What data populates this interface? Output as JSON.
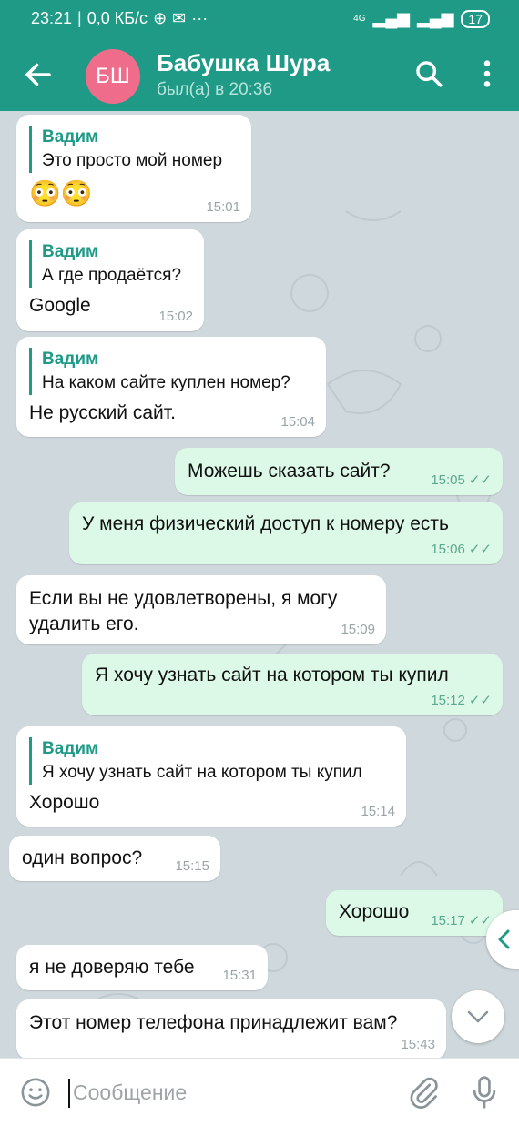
{
  "status": {
    "time": "23:21",
    "speed": "0,0 КБ/с",
    "network": "4G",
    "battery": "17"
  },
  "header": {
    "title": "Бабушка Шура",
    "subtitle": "был(а) в 20:36",
    "avatar_initials": "БШ"
  },
  "messages": [
    {
      "dir": "in",
      "quote_name": "Вадим",
      "quote_text": "Это просто мой номер",
      "text": "😳😳",
      "time": "15:01"
    },
    {
      "dir": "in",
      "quote_name": "Вадим",
      "quote_text": "А где продаётся?",
      "text": "Google",
      "time": "15:02"
    },
    {
      "dir": "in",
      "quote_name": "Вадим",
      "quote_text": "На каком сайте куплен номер?",
      "text": "Не русский сайт.",
      "time": "15:04"
    },
    {
      "dir": "out",
      "text": "Можешь сказать сайт?",
      "time": "15:05"
    },
    {
      "dir": "out",
      "text": "У меня физический доступ к номеру есть",
      "time": "15:06"
    },
    {
      "dir": "in",
      "text": "Если вы не удовлетворены, я могу удалить его.",
      "time": "15:09"
    },
    {
      "dir": "out",
      "text": "Я хочу узнать сайт на котором ты купил",
      "time": "15:12"
    },
    {
      "dir": "in",
      "quote_name": "Вадим",
      "quote_text": "Я хочу узнать сайт на котором ты купил",
      "text": "Хорошо",
      "time": "15:14"
    },
    {
      "dir": "in",
      "text": "один вопрос?",
      "time": "15:15"
    },
    {
      "dir": "out",
      "text": "Хорошо",
      "time": "15:17"
    },
    {
      "dir": "in",
      "text": "я не доверяю тебе",
      "time": "15:31"
    },
    {
      "dir": "in",
      "text": "Этот номер телефона принадлежит вам?",
      "time": "15:43"
    }
  ],
  "composer": {
    "placeholder": "Сообщение"
  },
  "colors": {
    "brand": "#1f9a87",
    "outgoing": "#dcf8e6",
    "incoming": "#ffffff",
    "avatar": "#ef6c8b"
  }
}
